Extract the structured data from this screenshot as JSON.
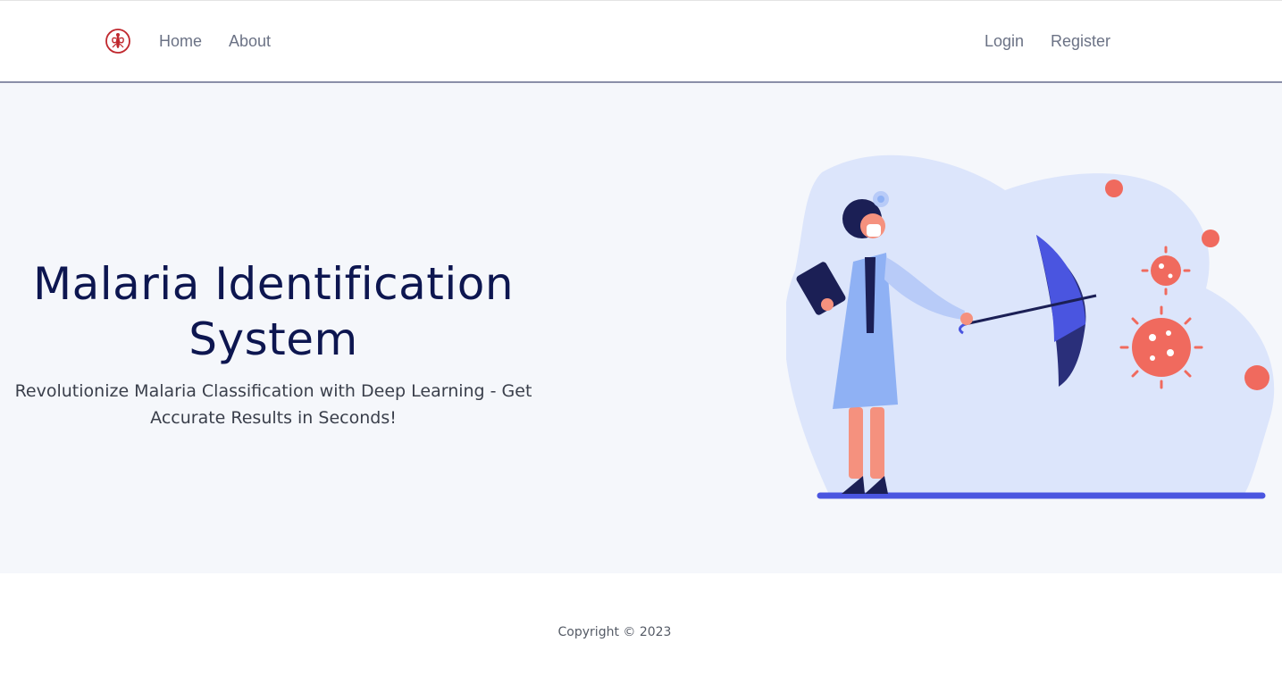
{
  "navbar": {
    "logo_icon": "mosquito-logo-icon",
    "left_links": [
      {
        "label": "Home"
      },
      {
        "label": "About"
      }
    ],
    "right_links": [
      {
        "label": "Login"
      },
      {
        "label": "Register"
      }
    ]
  },
  "hero": {
    "title": "Malaria Identification System",
    "subtitle": "Revolutionize Malaria Classification with Deep Learning - Get Accurate Results in Seconds!",
    "illustration_icon": "doctor-umbrella-virus-illustration"
  },
  "footer": {
    "copyright": "Copyright © 2023"
  },
  "colors": {
    "title": "#0d1650",
    "hero_background": "#f5f7fb",
    "accent_blue": "#4a55e0",
    "virus_red": "#f06a5e",
    "logo_red": "#c0282e"
  }
}
